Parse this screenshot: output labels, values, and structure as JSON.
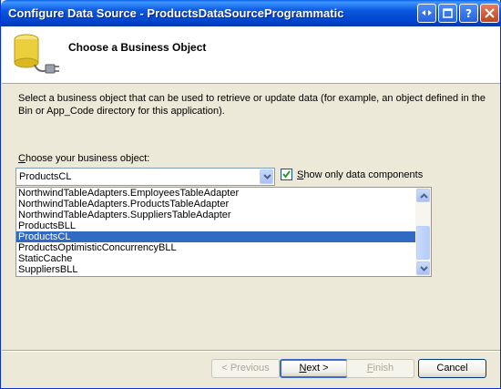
{
  "window": {
    "title": "Configure Data Source - ProductsDataSourceProgrammatic"
  },
  "header": {
    "heading": "Choose a Business Object",
    "icon": "database-plug-icon"
  },
  "description": "Select a business object that can be used to retrieve or update data (for example, an object defined in the Bin or App_Code directory for this application).",
  "business_object": {
    "label_accesskey": "C",
    "label_rest": "hoose your business object:",
    "selected_value": "ProductsCL"
  },
  "filter": {
    "checked": true,
    "label_accesskey": "S",
    "label_rest": "how only data components"
  },
  "list": {
    "items": [
      "NorthwindTableAdapters.EmployeesTableAdapter",
      "NorthwindTableAdapters.ProductsTableAdapter",
      "NorthwindTableAdapters.SuppliersTableAdapter",
      "ProductsBLL",
      "ProductsCL",
      "ProductsOptimisticConcurrencyBLL",
      "StaticCache",
      "SuppliersBLL"
    ],
    "selected_index": 4
  },
  "buttons": {
    "previous": "< Previous",
    "previous_accesskey": "P",
    "next_accesskey": "N",
    "next_rest": "ext >",
    "finish_accesskey": "F",
    "finish_rest": "inish",
    "cancel": "Cancel"
  },
  "colors": {
    "title_bar": "#0a58e0",
    "selection": "#316ac5",
    "dialog_bg": "#ece9d8"
  }
}
